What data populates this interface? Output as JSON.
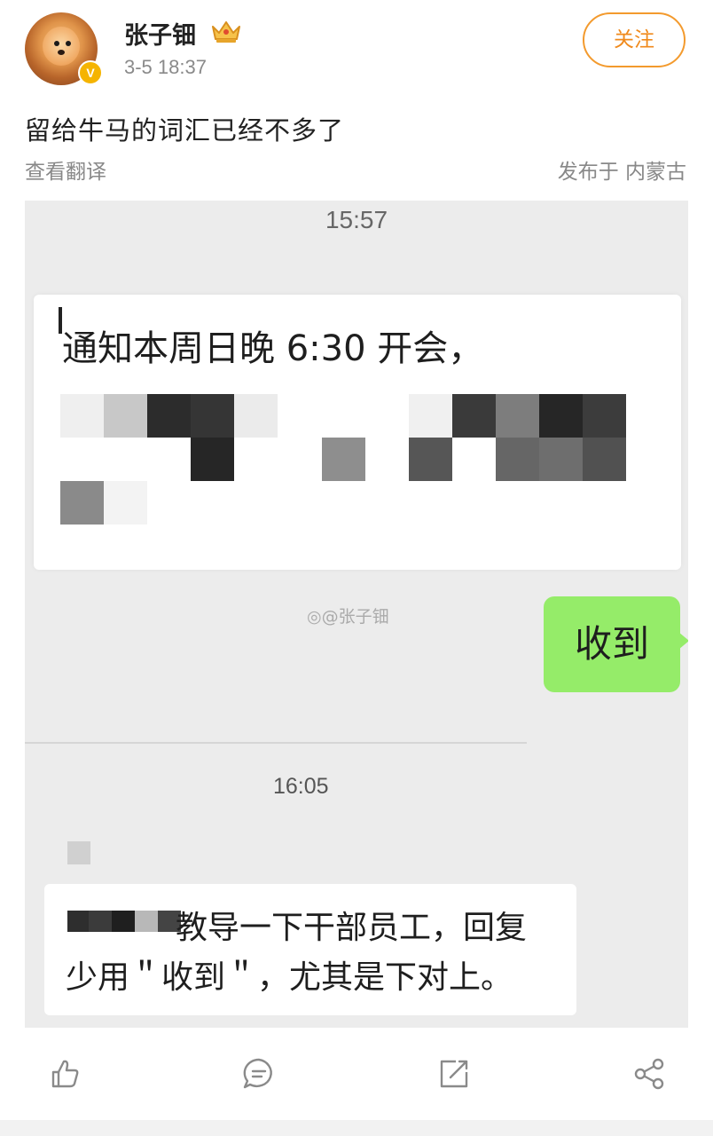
{
  "post": {
    "author": "张子钿",
    "timestamp": "3-5 18:37",
    "follow_label": "关注",
    "text": "留给牛马的词汇已经不多了",
    "translate_label": "查看翻译",
    "location": "发布于 内蒙古",
    "verified_badge": "V"
  },
  "screenshot": {
    "time1": "15:57",
    "message1": "通知本周日晚 6:30 开会，",
    "watermark": "@张子钿",
    "reply": "收到",
    "time2": "16:05",
    "message2_line1": "教导一下干部员工，回复",
    "message2_line2": "少用＂收到＂，尤其是下对上。"
  },
  "actions": [
    {
      "icon": "like-icon"
    },
    {
      "icon": "comment-icon"
    },
    {
      "icon": "repost-icon"
    },
    {
      "icon": "share-icon"
    }
  ],
  "colors": {
    "accent": "#f08a1c",
    "reply_bubble": "#95ec69"
  }
}
